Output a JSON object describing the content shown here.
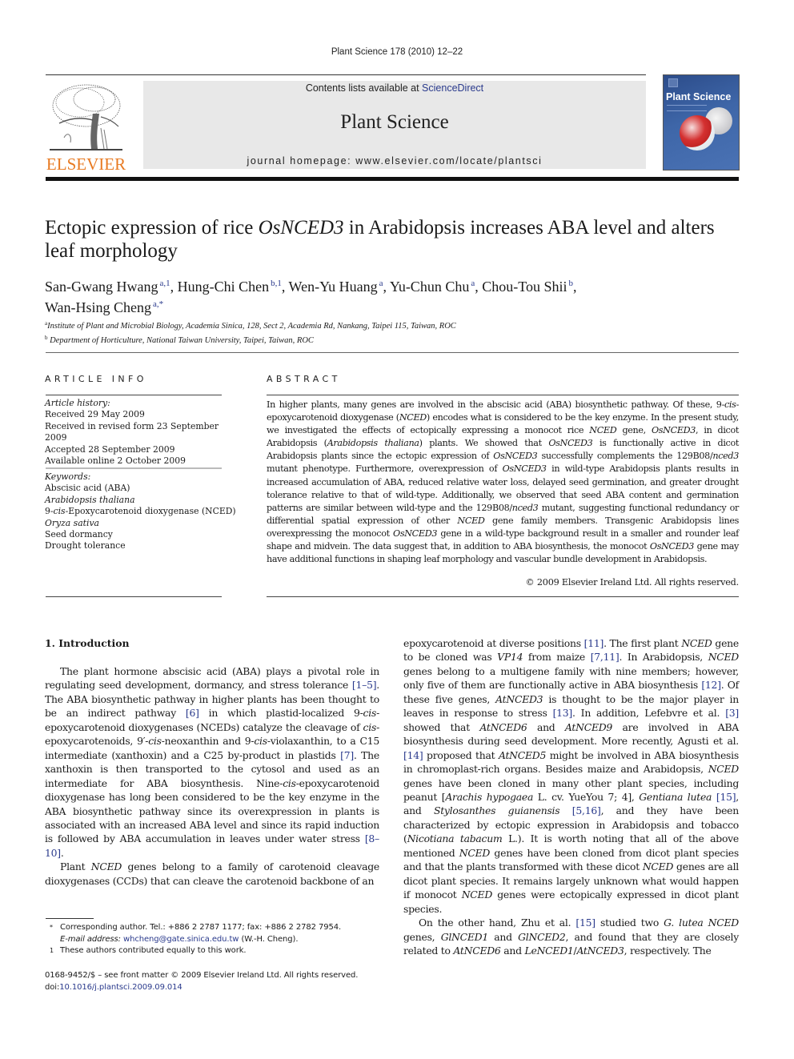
{
  "header": {
    "running_head": "Plant Science 178 (2010) 12–22",
    "contents_prefix": "Contents lists available at ",
    "contents_link": "ScienceDirect",
    "journal_title": "Plant Science",
    "homepage": "journal homepage: www.elsevier.com/locate/plantsci",
    "publisher_logo_text": "ELSEVIER",
    "cover_title": "Plant Science",
    "colors": {
      "publisher_orange": "#e87a22",
      "link_blue": "#2a3a8c",
      "masthead_grey": "#e8e8e8",
      "cover_blue": "#3e66a8"
    }
  },
  "article": {
    "title_part1": "Ectopic expression of rice ",
    "title_gene": "OsNCED3",
    "title_part2": " in Arabidopsis increases ABA level and alters leaf morphology",
    "authors": [
      {
        "name": "San-Gwang Hwang",
        "marks": "a,1"
      },
      {
        "name": "Hung-Chi Chen",
        "marks": "b,1"
      },
      {
        "name": "Wen-Yu Huang",
        "marks": "a"
      },
      {
        "name": "Yu-Chun Chu",
        "marks": "a"
      },
      {
        "name": "Chou-Tou Shii",
        "marks": "b"
      },
      {
        "name": "Wan-Hsing Cheng",
        "marks": "a,*"
      }
    ],
    "affiliations": [
      {
        "mark": "a",
        "text": "Institute of Plant and Microbial Biology, Academia Sinica, 128, Sect 2, Academia Rd, Nankang, Taipei 115, Taiwan, ROC"
      },
      {
        "mark": "b",
        "text": "Department of Horticulture, National Taiwan University, Taipei, Taiwan, ROC"
      }
    ]
  },
  "article_info": {
    "heading": "ARTICLE INFO",
    "history_label": "Article history:",
    "history": [
      "Received 29 May 2009",
      "Received in revised form 23 September 2009",
      "Accepted 28 September 2009",
      "Available online 2 October 2009"
    ],
    "keywords_label": "Keywords:",
    "keywords": [
      {
        "text": "Abscisic acid (ABA)",
        "italic": false
      },
      {
        "text": "Arabidopsis thaliana",
        "italic": true
      },
      {
        "text": "9-cis-Epoxycarotenoid dioxygenase (NCED)",
        "italic": false
      },
      {
        "text": "Oryza sativa",
        "italic": true
      },
      {
        "text": "Seed dormancy",
        "italic": false
      },
      {
        "text": "Drought tolerance",
        "italic": false
      }
    ]
  },
  "abstract": {
    "heading": "ABSTRACT",
    "text": "In higher plants, many genes are involved in the abscisic acid (ABA) biosynthetic pathway. Of these, 9-cis-epoxycarotenoid dioxygenase (NCED) encodes what is considered to be the key enzyme. In the present study, we investigated the effects of ectopically expressing a monocot rice NCED gene, OsNCED3, in dicot Arabidopsis (Arabidopsis thaliana) plants. We showed that OsNCED3 is functionally active in dicot Arabidopsis plants since the ectopic expression of OsNCED3 successfully complements the 129B08/nced3 mutant phenotype. Furthermore, overexpression of OsNCED3 in wild-type Arabidopsis plants results in increased accumulation of ABA, reduced relative water loss, delayed seed germination, and greater drought tolerance relative to that of wild-type. Additionally, we observed that seed ABA content and germination patterns are similar between wild-type and the 129B08/nced3 mutant, suggesting functional redundancy or differential spatial expression of other NCED gene family members. Transgenic Arabidopsis lines overexpressing the monocot OsNCED3 gene in a wild-type background result in a smaller and rounder leaf shape and midvein. The data suggest that, in addition to ABA biosynthesis, the monocot OsNCED3 gene may have additional functions in shaping leaf morphology and vascular bundle development in Arabidopsis.",
    "copyright": "© 2009 Elsevier Ireland Ltd. All rights reserved."
  },
  "introduction": {
    "heading": "1.  Introduction",
    "paragraphs": [
      "The plant hormone abscisic acid (ABA) plays a pivotal role in regulating seed development, dormancy, and stress tolerance [1–5]. The ABA biosynthetic pathway in higher plants has been thought to be an indirect pathway [6] in which plastid-localized 9-cis-epoxycarotenoid dioxygenases (NCEDs) catalyze the cleavage of cis-epoxycarotenoids, 9′-cis-neoxanthin and 9-cis-violaxanthin, to a C15 intermediate (xanthoxin) and a C25 by-product in plastids [7]. The xanthoxin is then transported to the cytosol and used as an intermediate for ABA biosynthesis. Nine-cis-epoxycarotenoid dioxygenase has long been considered to be the key enzyme in the ABA biosynthetic pathway since its overexpression in plants is associated with an increased ABA level and since its rapid induction is followed by ABA accumulation in leaves under water stress [8–10].",
      "Plant NCED genes belong to a family of carotenoid cleavage dioxygenases (CCDs) that can cleave the carotenoid backbone of an epoxycarotenoid at diverse positions [11]. The first plant NCED gene to be cloned was VP14 from maize [7,11]. In Arabidopsis, NCED genes belong to a multigene family with nine members; however, only five of them are functionally active in ABA biosynthesis [12]. Of these five genes, AtNCED3 is thought to be the major player in leaves in response to stress [13]. In addition, Lefebvre et al. [3] showed that AtNCED6 and AtNCED9 are involved in ABA biosynthesis during seed development. More recently, Agusti et al. [14] proposed that AtNCED5 might be involved in ABA biosynthesis in chromoplast-rich organs. Besides maize and Arabidopsis, NCED genes have been cloned in many other plant species, including peanut [Arachis hypogaea L. cv. YueYou 7; 4], Gentiana lutea [15], and Stylosanthes guianensis [5,16], and they have been characterized by ectopic expression in Arabidopsis and tobacco (Nicotiana tabacum L.). It is worth noting that all of the above mentioned NCED genes have been cloned from dicot plant species and that the plants transformed with these dicot NCED genes are all dicot plant species. It remains largely unknown what would happen if monocot NCED genes were ectopically expressed in dicot plant species.",
      "On the other hand, Zhu et al. [15] studied two G. lutea NCED genes, GlNCED1 and GlNCED2, and found that they are closely related to AtNCED6 and LeNCED1/AtNCED3, respectively. The"
    ]
  },
  "footnotes": {
    "corresponding_mark": "*",
    "corresponding": "Corresponding author. Tel.: +886 2 2787 1177; fax: +886 2 2782 7954.",
    "email_label": "E-mail address:",
    "email": "whcheng@gate.sinica.edu.tw",
    "email_suffix": " (W.-H. Cheng).",
    "equal_mark": "1",
    "equal": "These authors contributed equally to this work.",
    "front_matter": "0168-9452/$ – see front matter © 2009 Elsevier Ireland Ltd. All rights reserved.",
    "doi_prefix": "doi:",
    "doi": "10.1016/j.plantsci.2009.09.014"
  }
}
